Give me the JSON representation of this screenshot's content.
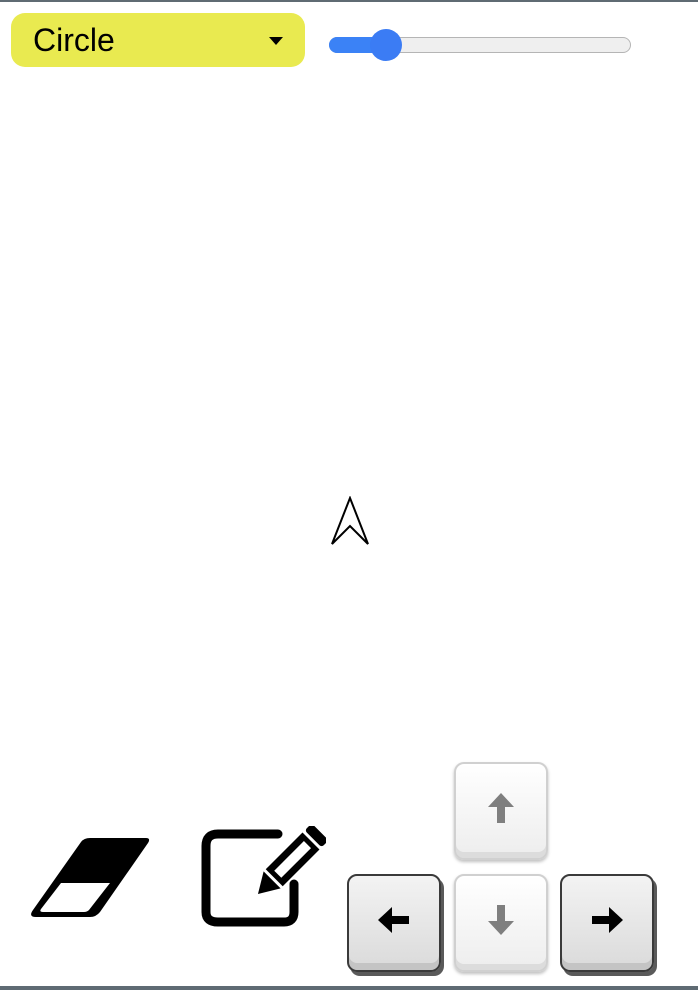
{
  "shape_select": {
    "value": "Circle",
    "caret_icon": "caret-down-icon",
    "color": "#e9ea50"
  },
  "speed_slider": {
    "value_fraction": 0.15,
    "accent_color": "#3b7cf4"
  },
  "turtle": {
    "icon": "navigation-arrow-icon",
    "heading": "up"
  },
  "tools": [
    {
      "name": "eraser",
      "icon": "eraser-icon"
    },
    {
      "name": "pen",
      "icon": "edit-pencil-icon"
    }
  ],
  "arrow_keys": [
    {
      "name": "up",
      "icon": "arrow-up-icon",
      "state": "dimmed"
    },
    {
      "name": "left",
      "icon": "arrow-left-icon",
      "state": "active"
    },
    {
      "name": "down",
      "icon": "arrow-down-icon",
      "state": "dimmed"
    },
    {
      "name": "right",
      "icon": "arrow-right-icon",
      "state": "active"
    }
  ]
}
